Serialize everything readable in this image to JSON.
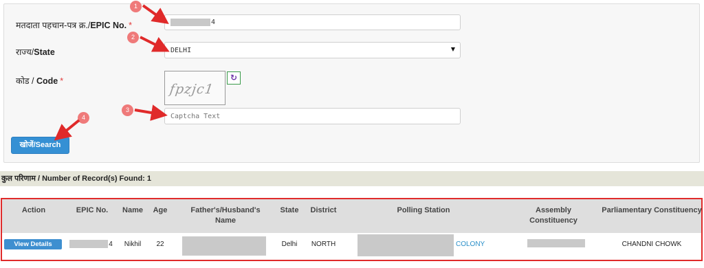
{
  "form": {
    "epic_label": "मतदाता पहचान-पत्र क्र./",
    "epic_label_en": "EPIC No.",
    "required_mark": "*",
    "epic_value_suffix": "4",
    "state_label": "राज्य/",
    "state_label_en": "State",
    "state_value": "DELHI",
    "code_label": "कोड / ",
    "code_label_en": "Code",
    "captcha_image_text": "fpzjc1",
    "captcha_placeholder": "Captcha Text",
    "search_button": "खोजें/Search"
  },
  "annotations": [
    "1",
    "2",
    "3",
    "4"
  ],
  "records_found": "कुल परिणाम / Number of Record(s) Found: 1",
  "table": {
    "headers": {
      "action": "Action",
      "epic": "EPIC No.",
      "name": "Name",
      "age": "Age",
      "father": "Father's/Husband's Name",
      "state": "State",
      "district": "District",
      "polling": "Polling Station",
      "assembly": "Assembly Constituency",
      "parliamentary": "Parliamentary Constituency"
    },
    "row": {
      "action_button": "View Details",
      "epic_suffix": "4",
      "name": "Nikhil",
      "age": "22",
      "state": "Delhi",
      "district": "NORTH",
      "polling_suffix": "COLONY",
      "parliamentary": "CHANDNI CHOWK"
    }
  },
  "colors": {
    "accent": "#3590d4",
    "annotation_arrow": "#e02a2a",
    "badge": "#ef7a7a",
    "link": "#2a8fc9"
  }
}
